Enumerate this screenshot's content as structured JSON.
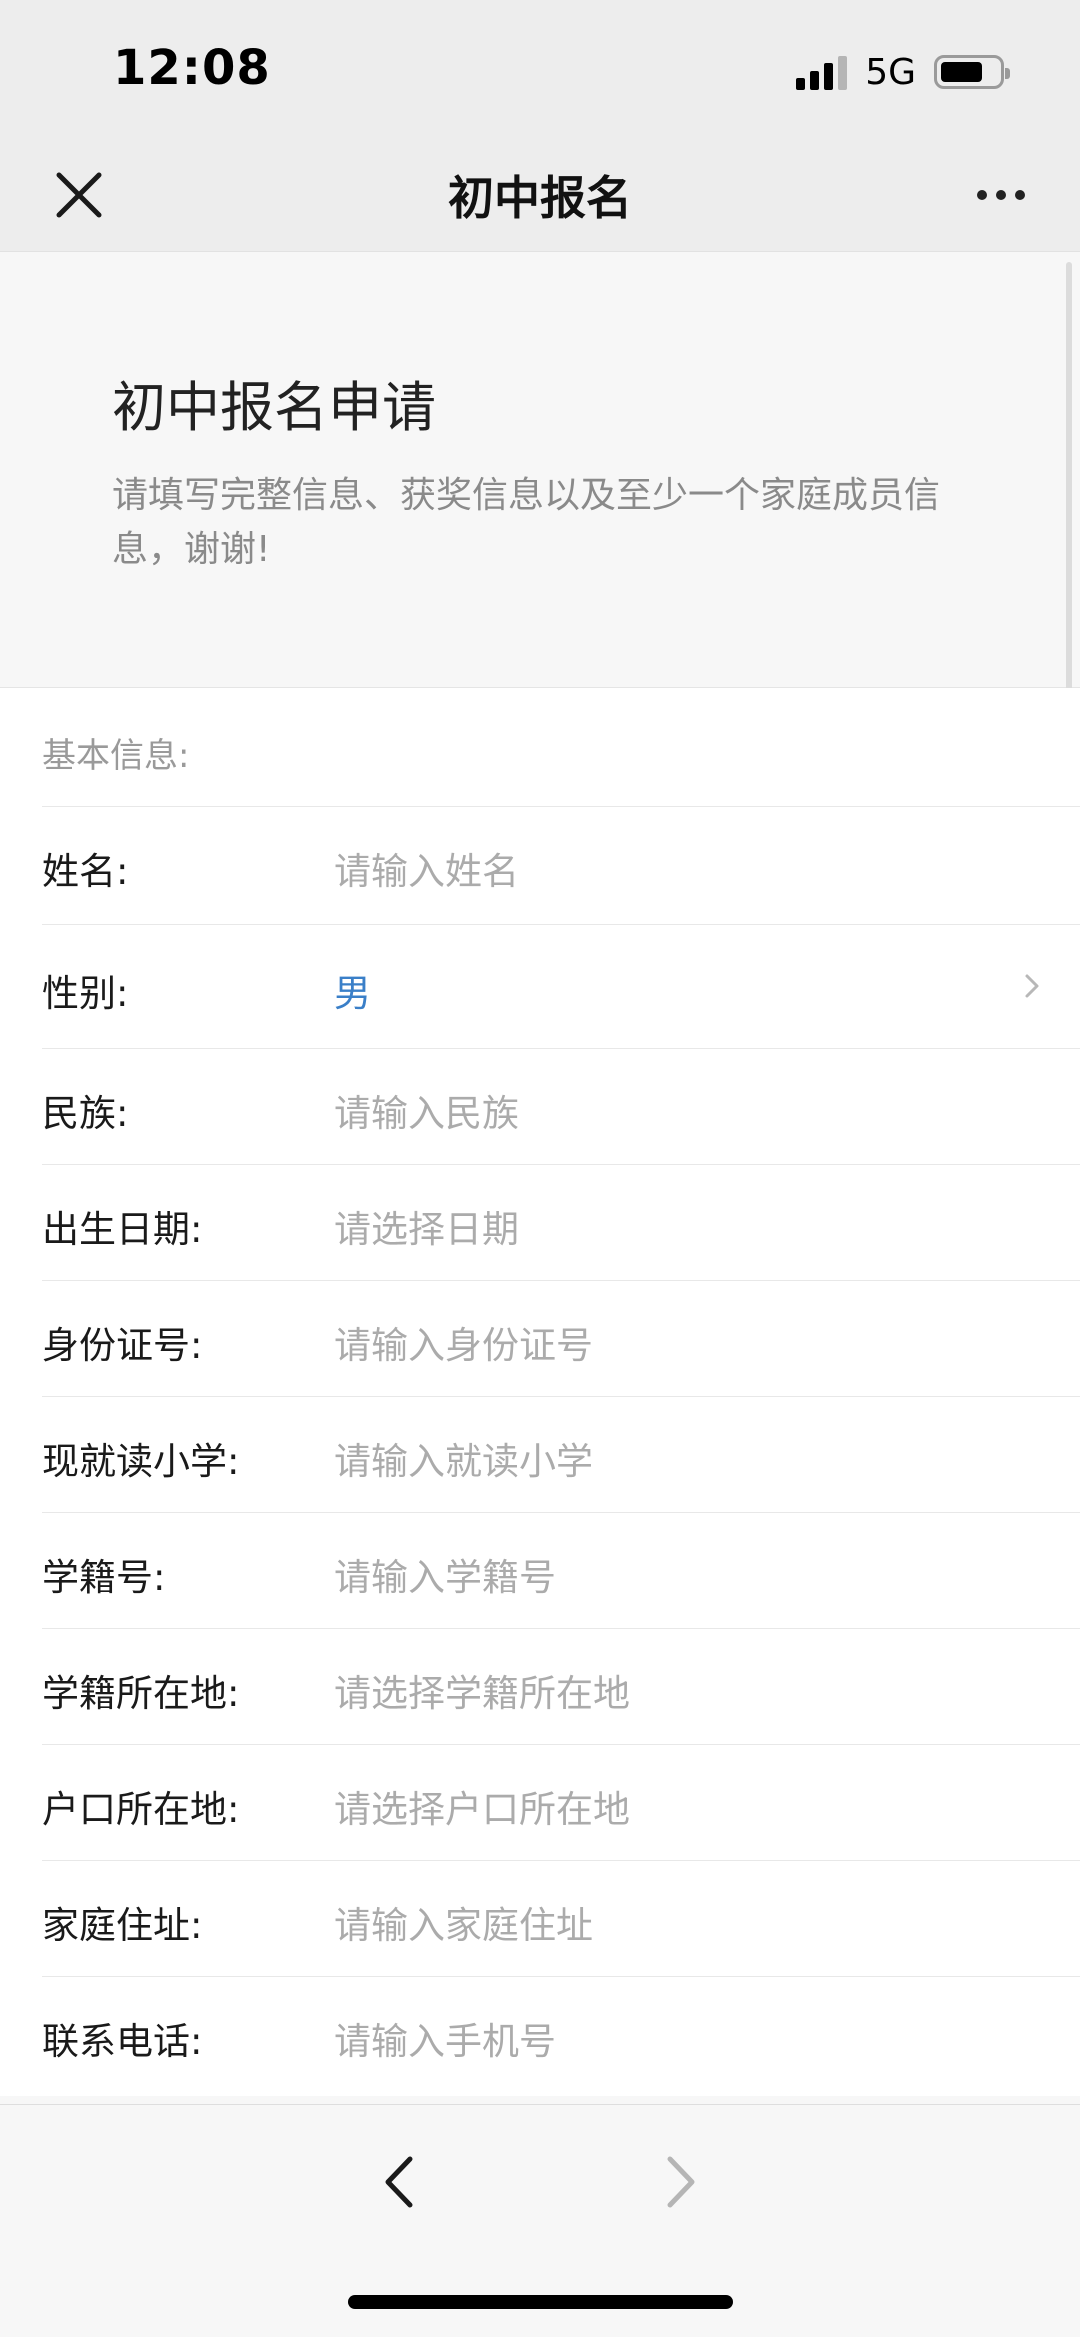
{
  "status_bar": {
    "time": "12:08",
    "network": "5G",
    "battery_level": 0.7
  },
  "nav": {
    "title": "初中报名",
    "close_icon": "close-icon",
    "more_icon": "more-icon"
  },
  "header": {
    "title": "初中报名申请",
    "description": "请填写完整信息、获奖信息以及至少一个家庭成员信息，谢谢!"
  },
  "section": {
    "label": "基本信息:"
  },
  "fields": [
    {
      "label": "姓名:",
      "value": "请输入姓名",
      "type": "input"
    },
    {
      "label": "性别:",
      "value": "男",
      "type": "select"
    },
    {
      "label": "民族:",
      "value": "请输入民族",
      "type": "input"
    },
    {
      "label": "出生日期:",
      "value": "请选择日期",
      "type": "picker"
    },
    {
      "label": "身份证号:",
      "value": "请输入身份证号",
      "type": "input"
    },
    {
      "label": "现就读小学:",
      "value": "请输入就读小学",
      "type": "input"
    },
    {
      "label": "学籍号:",
      "value": "请输入学籍号",
      "type": "input"
    },
    {
      "label": "学籍所在地:",
      "value": "请选择学籍所在地",
      "type": "picker"
    },
    {
      "label": "户口所在地:",
      "value": "请选择户口所在地",
      "type": "picker"
    },
    {
      "label": "家庭住址:",
      "value": "请输入家庭住址",
      "type": "input"
    },
    {
      "label": "联系电话:",
      "value": "请输入手机号",
      "type": "input"
    }
  ],
  "colors": {
    "accent": "#3a7fc8",
    "placeholder": "#ababab",
    "bar_background": "#ededed"
  },
  "toolbar": {
    "back_icon": "chevron-left-icon",
    "forward_icon": "chevron-right-icon"
  }
}
